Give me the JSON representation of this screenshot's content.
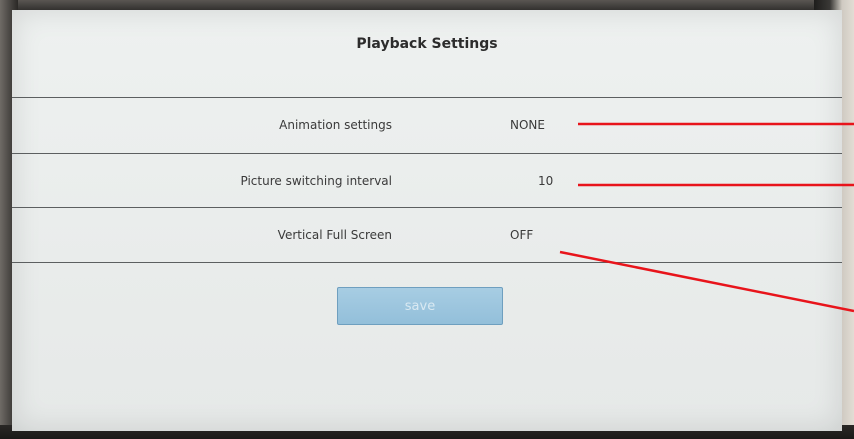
{
  "header": {
    "title": "Playback Settings"
  },
  "settings": [
    {
      "label": "Animation settings",
      "value": "NONE"
    },
    {
      "label": "Picture switching interval",
      "value": "10"
    },
    {
      "label": "Vertical Full Screen",
      "value": "OFF"
    }
  ],
  "actions": {
    "save_label": "save"
  },
  "colors": {
    "screen_bg": "#eceeed",
    "button_bg": "#9fc8df",
    "button_text": "#d9e9f2",
    "annotation_line": "#ff0000"
  }
}
